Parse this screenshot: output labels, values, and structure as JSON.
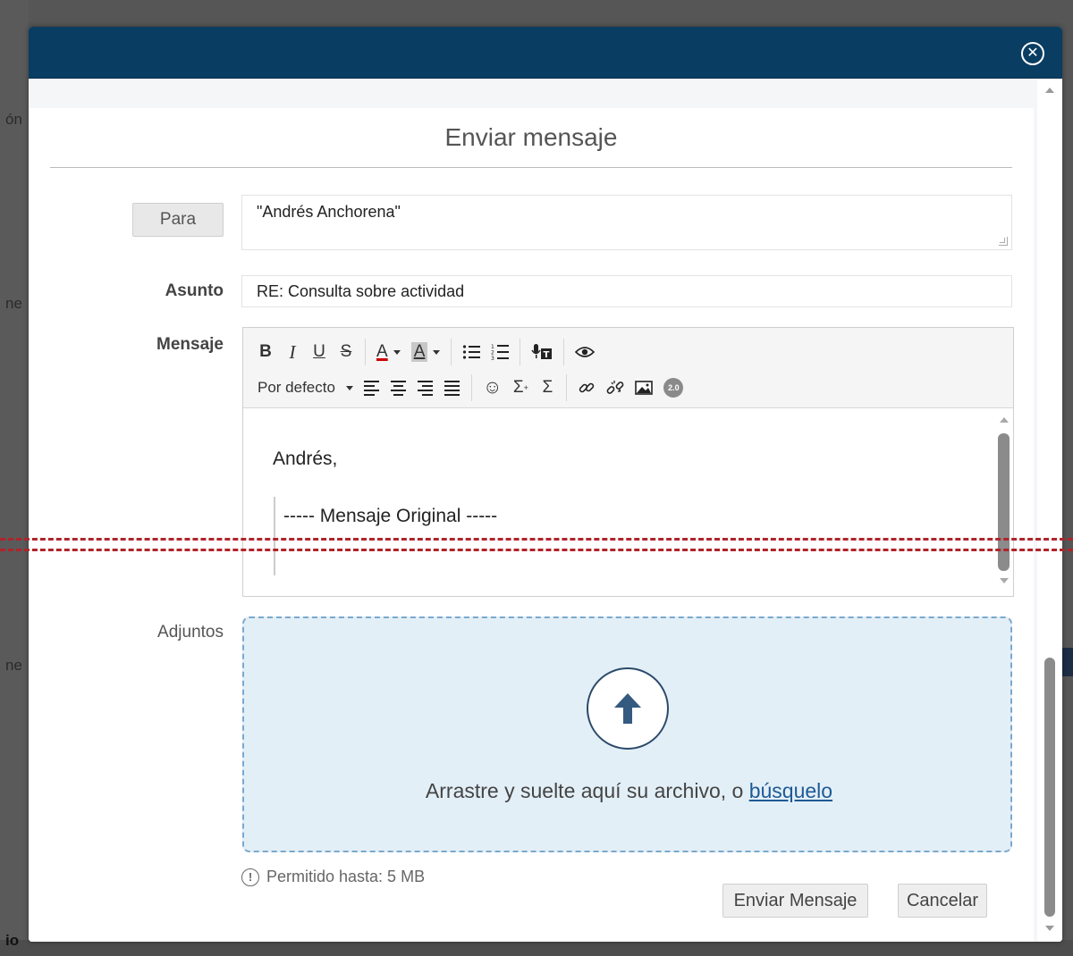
{
  "background": {
    "fragments": [
      "ón",
      "ne",
      "ne",
      "io"
    ]
  },
  "dialog": {
    "title": "Enviar mensaje",
    "close_icon": "close-circle-icon"
  },
  "form": {
    "to_button": "Para",
    "to_value": "\"Andrés Anchorena\"",
    "subject_label": "Asunto",
    "subject_value": "RE: Consulta sobre actividad",
    "message_label": "Mensaje",
    "attachments_label": "Adjuntos"
  },
  "toolbar": {
    "bold": "B",
    "italic": "I",
    "underline": "U",
    "strike": "S",
    "font_color": "A",
    "bg_color": "A",
    "font_select": "Por defecto",
    "subscript": "Σ",
    "superscript": "Σ",
    "badge": "2.0"
  },
  "editor": {
    "greeting": "Andrés,",
    "original_header": "----- Mensaje Original -----"
  },
  "dropzone": {
    "text": "Arrastre y suelte aquí su archivo, o",
    "link": "búsquelo",
    "limit": "Permitido hasta: 5 MB"
  },
  "actions": {
    "send": "Enviar Mensaje",
    "cancel": "Cancelar"
  },
  "colors": {
    "header": "#0a3d62",
    "dropzone_bg": "#e3eff7",
    "dropzone_border": "#7aa8cc",
    "link": "#1e5a96",
    "overlay_dash": "#b0242b"
  }
}
